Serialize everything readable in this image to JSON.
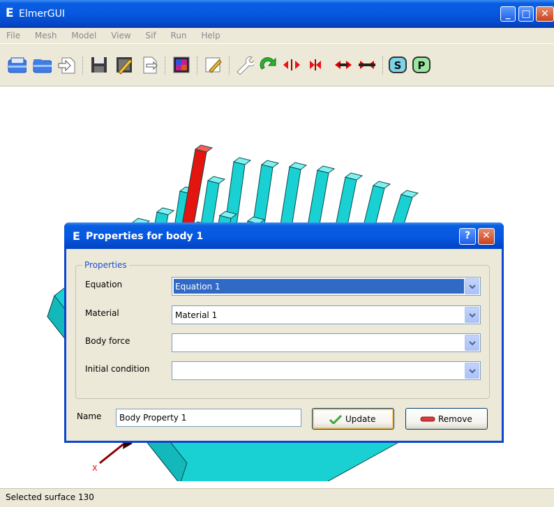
{
  "window": {
    "app_letter": "E",
    "title": "ElmerGUI",
    "minimize_glyph": "_",
    "maximize_glyph": "□",
    "close_glyph": "✕"
  },
  "menu": [
    "File",
    "Mesh",
    "Model",
    "View",
    "Sif",
    "Run",
    "Help"
  ],
  "toolbar": {
    "icons": [
      "new-icon",
      "open-icon",
      "load-icon",
      "save-icon",
      "edit-icon",
      "export-icon",
      "colormap-icon",
      "sif-edit-icon",
      "tools-wrench-icon",
      "refresh-icon",
      "divide-surface-icon",
      "unify-surface-icon",
      "divide-edge-icon",
      "unify-edge-icon",
      "solver-s-icon",
      "postprocessor-p-icon"
    ],
    "solver_label": "S",
    "post_label": "P"
  },
  "viewport": {
    "axis_label": "X",
    "colors": {
      "bars": "#19d1d3",
      "selected_bar": "#e4140f",
      "bar_edge": "#0b4a4a"
    }
  },
  "dialog": {
    "app_letter": "E",
    "title": "Properties for body 1",
    "help_glyph": "?",
    "close_glyph": "✕",
    "group_label": "Properties",
    "fields": [
      {
        "label": "Equation",
        "value": "Equation 1"
      },
      {
        "label": "Material",
        "value": "Material 1"
      },
      {
        "label": "Body force",
        "value": ""
      },
      {
        "label": "Initial condition",
        "value": ""
      }
    ],
    "name_label": "Name",
    "name_value": "Body Property 1",
    "update_label": "Update",
    "remove_label": "Remove"
  },
  "status": {
    "text": "Selected surface 130"
  }
}
